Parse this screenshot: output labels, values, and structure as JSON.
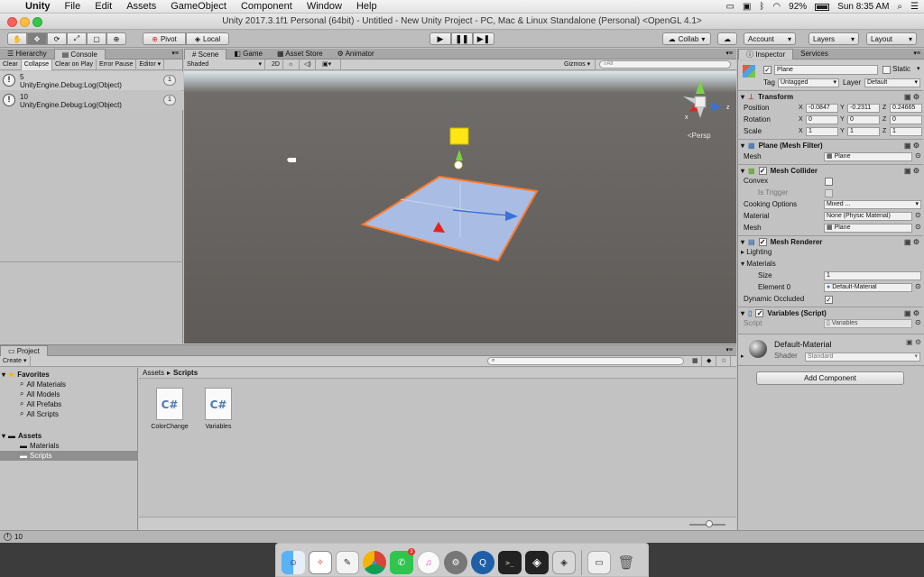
{
  "menubar": {
    "app": "Unity",
    "items": [
      "File",
      "Edit",
      "Assets",
      "GameObject",
      "Component",
      "Window",
      "Help"
    ],
    "battery": "92%",
    "clock": "Sun 8:35 AM"
  },
  "window": {
    "title": "Unity 2017.3.1f1 Personal (64bit) - Untitled - New Unity Project - PC, Mac & Linux Standalone (Personal) <OpenGL 4.1>"
  },
  "toolbar": {
    "pivot": "Pivot",
    "local": "Local",
    "collab": "Collab",
    "account": "Account",
    "layers": "Layers",
    "layout": "Layout"
  },
  "hierarchy": {
    "tabs": [
      "Hierarchy",
      "Console"
    ],
    "buttons": [
      "Clear",
      "Collapse",
      "Clear on Play",
      "Error Pause",
      "Editor"
    ],
    "logs": [
      {
        "line1": "5",
        "line2": "UnityEngine.Debug:Log(Object)",
        "count": "1"
      },
      {
        "line1": "10",
        "line2": "UnityEngine.Debug:Log(Object)",
        "count": "1"
      }
    ]
  },
  "scene": {
    "tabs": [
      "Scene",
      "Game",
      "Asset Store",
      "Animator"
    ],
    "shaded": "Shaded",
    "mode2d": "2D",
    "gizmos": "Gizmos",
    "search_placeholder": "All",
    "persp": "Persp"
  },
  "project": {
    "tab": "Project",
    "create": "Create",
    "favorites_label": "Favorites",
    "favorites": [
      "All Materials",
      "All Models",
      "All Prefabs",
      "All Scripts"
    ],
    "assets_label": "Assets",
    "assets": [
      "Materials",
      "Scripts"
    ],
    "breadcrumb": [
      "Assets",
      "Scripts"
    ],
    "files": [
      {
        "name": "ColorChange",
        "icon": "C#"
      },
      {
        "name": "Variables",
        "icon": "C#"
      }
    ]
  },
  "inspector": {
    "tabs": [
      "Inspector",
      "Services"
    ],
    "object_name": "Plane",
    "static_label": "Static",
    "tag_label": "Tag",
    "tag_value": "Untagged",
    "layer_label": "Layer",
    "layer_value": "Default",
    "transform": {
      "title": "Transform",
      "position_label": "Position",
      "rotation_label": "Rotation",
      "scale_label": "Scale",
      "position": [
        "-0.0847",
        "-0.2311",
        "0.24665"
      ],
      "rotation": [
        "0",
        "0",
        "0"
      ],
      "scale": [
        "1",
        "1",
        "1"
      ]
    },
    "mesh_filter": {
      "title": "Plane (Mesh Filter)",
      "mesh_label": "Mesh",
      "mesh_value": "Plane"
    },
    "mesh_collider": {
      "title": "Mesh Collider",
      "convex": "Convex",
      "is_trigger": "Is Trigger",
      "cooking_label": "Cooking Options",
      "cooking_value": "Mixed ...",
      "material_label": "Material",
      "material_value": "None (Physic Material)",
      "mesh_label": "Mesh",
      "mesh_value": "Plane"
    },
    "mesh_renderer": {
      "title": "Mesh Renderer",
      "lighting": "Lighting",
      "materials": "Materials",
      "size_label": "Size",
      "size_value": "1",
      "element_label": "Element 0",
      "element_value": "Default-Material",
      "dynamic_label": "Dynamic Occluded"
    },
    "script": {
      "title": "Variables (Script)",
      "script_label": "Script",
      "script_value": "Variables"
    },
    "material": {
      "name": "Default-Material",
      "shader_label": "Shader",
      "shader_value": "Standard"
    },
    "add_component": "Add Component"
  },
  "status": {
    "text": "10"
  },
  "colors": {
    "accent": "#3a72d8",
    "selection": "#8f8f8f",
    "plane_edge": "#ff7a2a"
  }
}
